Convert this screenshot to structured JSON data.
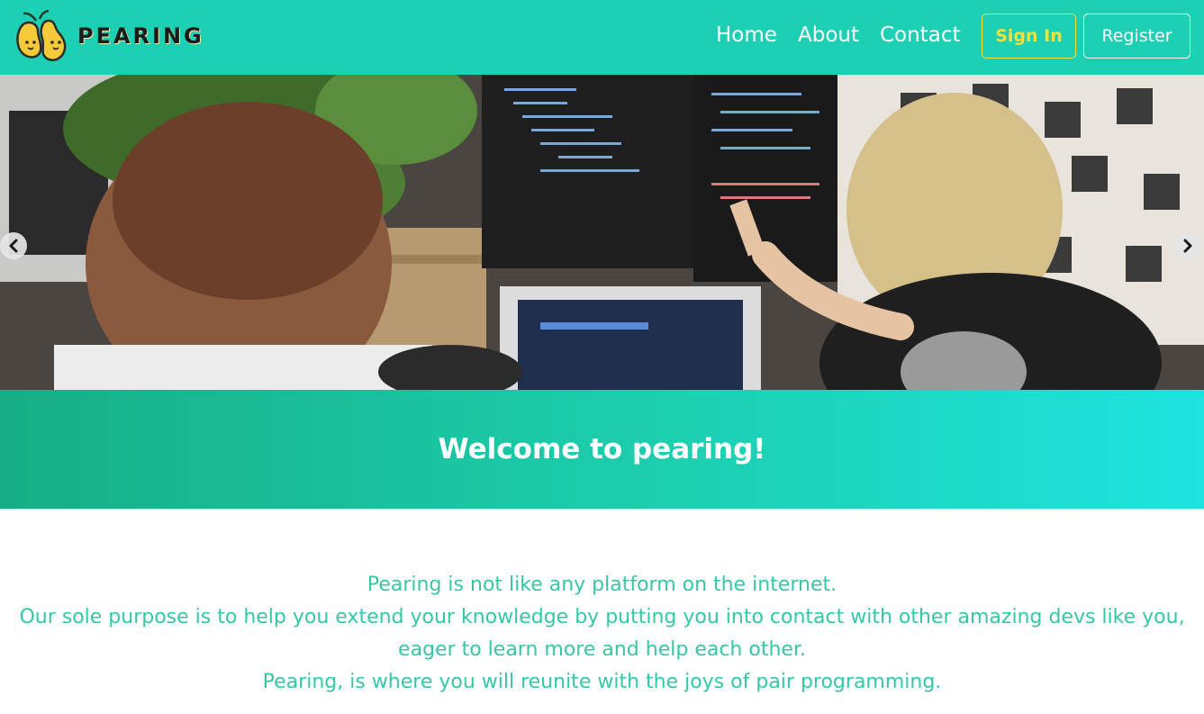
{
  "brand": {
    "name": "PEARING",
    "logo_icon": "pear-logo-icon"
  },
  "nav": {
    "links": [
      "Home",
      "About",
      "Contact"
    ],
    "sign_in": "Sign In",
    "register": "Register"
  },
  "carousel": {
    "prev_icon": "chevron-left-icon",
    "next_icon": "chevron-right-icon"
  },
  "welcome": {
    "title": "Welcome to pearing!"
  },
  "intro": {
    "line1": "Pearing is not like any platform on the internet.",
    "line2": "Our sole purpose is to help you extend your knowledge by putting you into contact with other amazing devs like you, eager to learn more and help each other.",
    "line3": "Pearing, is where you will reunite with the joys of pair programming."
  },
  "colors": {
    "navbar": "#1dcfb3",
    "sign_in_accent": "#f4e23a",
    "intro_text": "#35c8a7",
    "welcome_gradient_start": "#17ae85",
    "welcome_gradient_end": "#1ee3e0"
  }
}
